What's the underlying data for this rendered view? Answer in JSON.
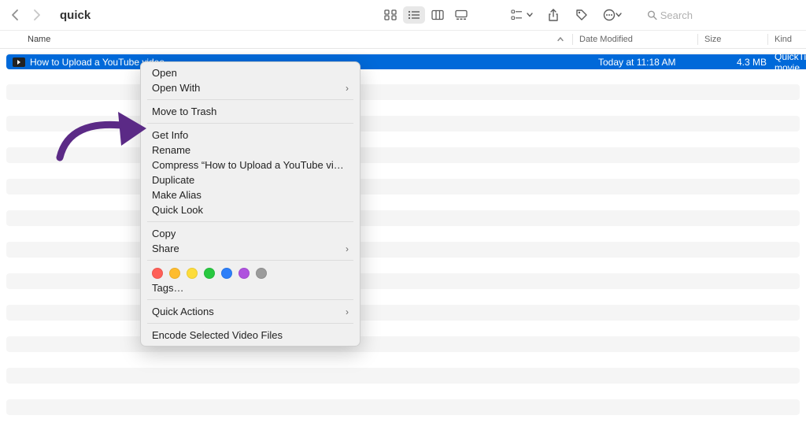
{
  "window": {
    "title": "quick"
  },
  "search": {
    "placeholder": "Search"
  },
  "columns": {
    "name": "Name",
    "date": "Date Modified",
    "size": "Size",
    "kind": "Kind"
  },
  "file": {
    "name": "How to Upload a YouTube video",
    "date": "Today at 11:18 AM",
    "size": "4.3 MB",
    "kind": "QuickTime movie"
  },
  "menu": {
    "open": "Open",
    "open_with": "Open With",
    "trash": "Move to Trash",
    "get_info": "Get Info",
    "rename": "Rename",
    "compress": "Compress “How to Upload a YouTube video”",
    "duplicate": "Duplicate",
    "make_alias": "Make Alias",
    "quick_look": "Quick Look",
    "copy": "Copy",
    "share": "Share",
    "tags": "Tags…",
    "quick_actions": "Quick Actions",
    "encode": "Encode Selected Video Files"
  },
  "tag_colors": [
    "#ff5f57",
    "#febc2e",
    "#fddc3b",
    "#28c840",
    "#2d7ff9",
    "#af52de",
    "#9b9b9b"
  ]
}
